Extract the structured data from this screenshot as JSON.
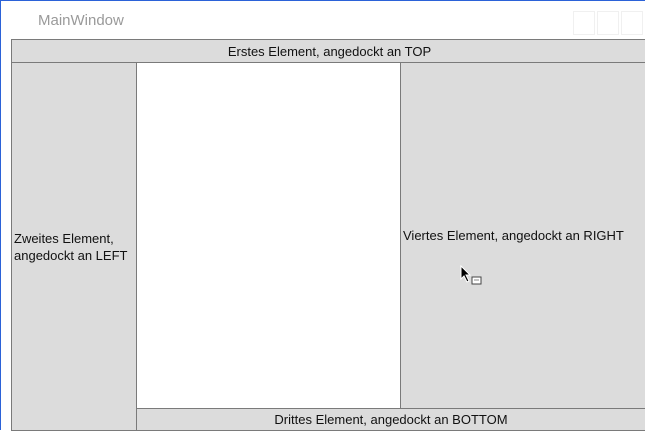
{
  "window": {
    "title": "MainWindow"
  },
  "dock_panel": {
    "top_label": "Erstes Element, angedockt an TOP",
    "left_label_line1": "Zweites Element,",
    "left_label_line2": "angedockt an LEFT",
    "bottom_label": "Drittes Element, angedockt an BOTTOM",
    "right_label": "Viertes Element, angedockt an RIGHT"
  },
  "colors": {
    "window_border": "#2b62d8",
    "dock_background": "#dcdcdc",
    "dock_border": "#7a7a7a",
    "title_text": "#9a9a9a"
  },
  "icons": {
    "cursor": "arrow-with-drag-box-icon"
  }
}
